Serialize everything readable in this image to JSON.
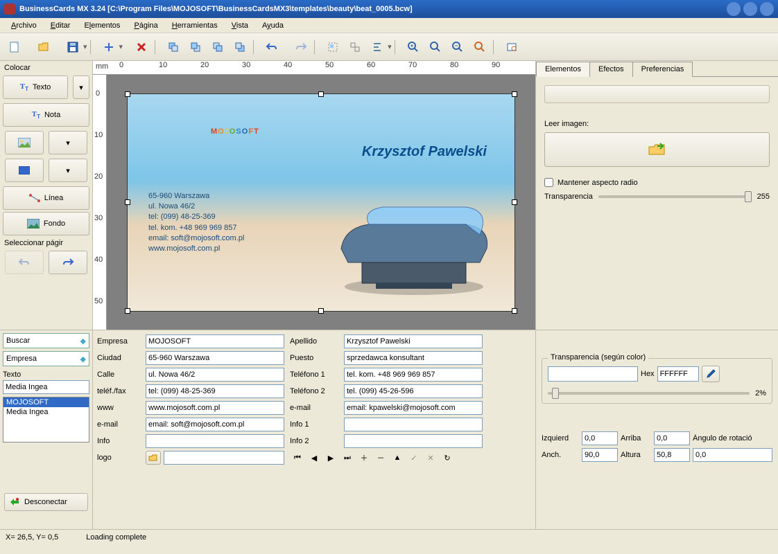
{
  "title": "BusinessCards MX 3.24  [C:\\Program Files\\MOJOSOFT\\BusinessCardsMX3\\templates\\beauty\\beat_0005.bcw]",
  "menu": [
    "Archivo",
    "Editar",
    "Elementos",
    "Página",
    "Herramientas",
    "Vista",
    "Ayuda"
  ],
  "left": {
    "hdr": "Colocar",
    "texto": "Texto",
    "nota": "Nota",
    "linea": "Línea",
    "fondo": "Fondo",
    "sel": "Seleccionar págir",
    "desconectar": "Desconectar"
  },
  "ruler_unit": "mm",
  "card": {
    "logo": "MOJOSOFT",
    "subtitle": "Krzysztof Pawelski",
    "addr": [
      "65-960 Warszawa",
      "ul. Nowa 46/2",
      "tel: (099) 48-25-369",
      "tel. kom. +48 969 969 857",
      "email: soft@mojosoft.com.pl",
      "www.mojosoft.com.pl"
    ]
  },
  "rtabs": [
    "Elementos",
    "Efectos",
    "Preferencias"
  ],
  "rp": {
    "leer": "Leer imagen:",
    "mantener": "Mantener aspecto radio",
    "transp": "Transparencia",
    "transp_val": "255",
    "group_title": "Transparencia (según color)",
    "hex_label": "Hex",
    "hex_val": "FFFFFF",
    "pct": "2%",
    "izq": "Izquierd",
    "izq_v": "0,0",
    "arr": "Arriba",
    "arr_v": "0,0",
    "ang": "Ángulo de rotació",
    "anch": "Anch.",
    "anch_v": "90,0",
    "alt": "Altura",
    "alt_v": "50,8",
    "ang_v": "0,0"
  },
  "bl": {
    "buscar": "Buscar",
    "empresa": "Empresa",
    "texto": "Texto",
    "list": [
      "Media Ingea",
      "MOJOSOFT",
      "Media Ingea"
    ],
    "sel_idx": 1
  },
  "form": {
    "empresa_l": "Empresa",
    "empresa_v": "MOJOSOFT",
    "apellido_l": "Apellido",
    "apellido_v": "Krzysztof Pawelski",
    "ciudad_l": "Ciudad",
    "ciudad_v": "65-960 Warszawa",
    "puesto_l": "Puesto",
    "puesto_v": "sprzedawca konsultant",
    "calle_l": "Calle",
    "calle_v": "ul. Nowa 46/2",
    "tel1_l": "Teléfono 1",
    "tel1_v": "tel. kom. +48 969 969 857",
    "telfax_l": "teléf./fax",
    "telfax_v": "tel: (099) 48-25-369",
    "tel2_l": "Teléfono 2",
    "tel2_v": "tel. (099) 45-26-596",
    "www_l": "www",
    "www_v": "www.mojosoft.com.pl",
    "email_l": "e-mail",
    "email_v": "email: kpawelski@mojosoft.com",
    "email2_l": "e-mail",
    "email2_v": "email: soft@mojosoft.com.pl",
    "info1_l": "Info 1",
    "info1_v": "",
    "info_l": "Info",
    "info_v": "",
    "info2_l": "Info 2",
    "info2_v": "",
    "logo_l": "logo",
    "logo_v": ""
  },
  "status": {
    "xy": "X= 26,5, Y=  0,5",
    "loading": "Loading complete"
  }
}
